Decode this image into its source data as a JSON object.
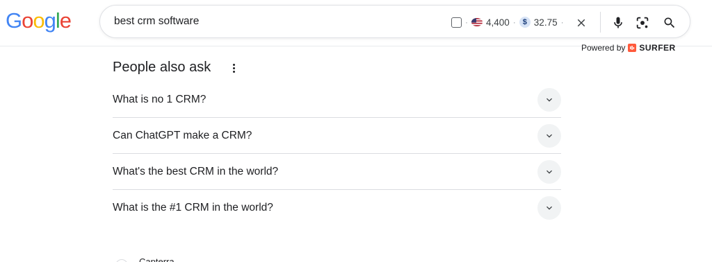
{
  "logo": {
    "letters": [
      "G",
      "o",
      "o",
      "g",
      "l",
      "e"
    ],
    "colors": [
      "#4285F4",
      "#EA4335",
      "#FBBC05",
      "#4285F4",
      "#34A853",
      "#EA4335"
    ]
  },
  "search": {
    "query": "best crm software",
    "volume": "4,400",
    "cpc": "32.75",
    "dollar_glyph": "$",
    "separator": "·"
  },
  "powered_by": {
    "label": "Powered by",
    "brand": "SURFER"
  },
  "paa": {
    "title": "People also ask",
    "questions": [
      "What is no 1 CRM?",
      "Can ChatGPT make a CRM?",
      "What's the best CRM in the world?",
      "What is the #1 CRM in the world?"
    ]
  },
  "next_result": {
    "site": "Capterra"
  },
  "colors": {
    "accent_blue": "#4285F4",
    "surfer": "#FF5A3C",
    "chevron_bg": "#F1F3F4"
  }
}
